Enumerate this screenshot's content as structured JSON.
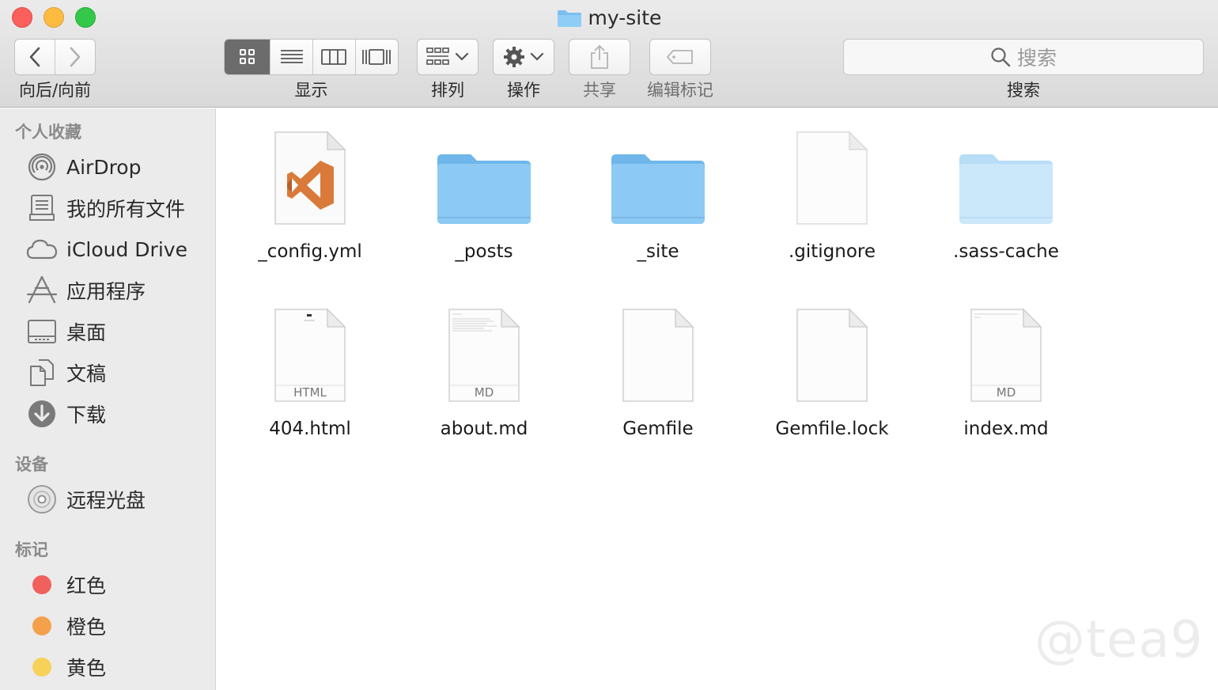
{
  "window": {
    "title": "my-site"
  },
  "toolbar": {
    "nav_label": "向后/向前",
    "view_label": "显示",
    "arrange_label": "排列",
    "action_label": "操作",
    "share_label": "共享",
    "tags_label": "编辑标记",
    "search_placeholder": "搜索",
    "search_label": "搜索"
  },
  "sidebar": {
    "favorites_header": "个人收藏",
    "favorites": [
      {
        "label": "AirDrop",
        "icon": "airdrop-icon"
      },
      {
        "label": "我的所有文件",
        "icon": "all-files-icon"
      },
      {
        "label": "iCloud Drive",
        "icon": "cloud-icon"
      },
      {
        "label": "应用程序",
        "icon": "applications-icon"
      },
      {
        "label": "桌面",
        "icon": "desktop-icon"
      },
      {
        "label": "文稿",
        "icon": "documents-icon"
      },
      {
        "label": "下载",
        "icon": "downloads-icon"
      }
    ],
    "devices_header": "设备",
    "devices": [
      {
        "label": "远程光盘",
        "icon": "disc-icon"
      }
    ],
    "tags_header": "标记",
    "tags": [
      {
        "label": "红色",
        "color": "#f0605c"
      },
      {
        "label": "橙色",
        "color": "#f5a04a"
      },
      {
        "label": "黄色",
        "color": "#f7d25a"
      }
    ]
  },
  "files": [
    {
      "name": "_config.yml",
      "kind": "vscode-doc"
    },
    {
      "name": "_posts",
      "kind": "folder"
    },
    {
      "name": "_site",
      "kind": "folder"
    },
    {
      "name": ".gitignore",
      "kind": "blank-doc"
    },
    {
      "name": ".sass-cache",
      "kind": "folder-light"
    },
    {
      "name": "404.html",
      "kind": "doc",
      "badge": "HTML"
    },
    {
      "name": "about.md",
      "kind": "doc",
      "badge": "MD"
    },
    {
      "name": "Gemfile",
      "kind": "blank-doc"
    },
    {
      "name": "Gemfile.lock",
      "kind": "blank-doc"
    },
    {
      "name": "index.md",
      "kind": "doc",
      "badge": "MD"
    }
  ],
  "watermark": "@tea9"
}
